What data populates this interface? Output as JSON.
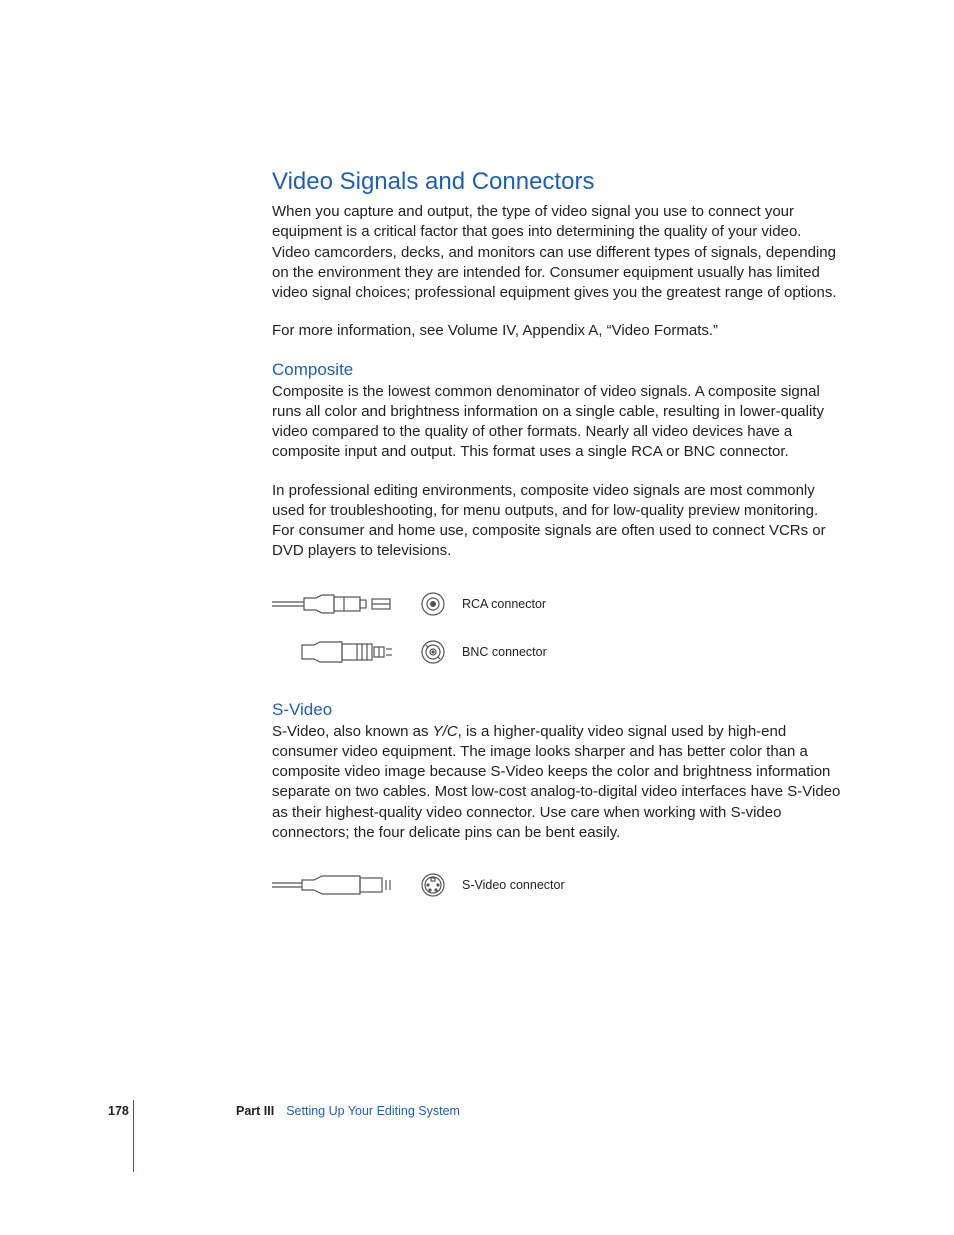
{
  "section": {
    "title": "Video Signals and Connectors",
    "intro_p1": "When you capture and output, the type of video signal you use to connect your equipment is a critical factor that goes into determining the quality of your video. Video camcorders, decks, and monitors can use different types of signals, depending on the environment they are intended for. Consumer equipment usually has limited video signal choices; professional equipment gives you the greatest range of options.",
    "intro_p2": "For more information, see Volume IV, Appendix A, “Video Formats.”"
  },
  "composite": {
    "heading": "Composite",
    "p1": "Composite is the lowest common denominator of video signals. A composite signal runs all color and brightness information on a single cable, resulting in lower-quality video compared to the quality of other formats. Nearly all video devices have a composite input and output. This format uses a single RCA or BNC connector.",
    "p2": "In professional editing environments, composite video signals are most commonly used for troubleshooting, for menu outputs, and for low-quality preview monitoring. For consumer and home use, composite signals are often used to connect VCRs or DVD players to televisions.",
    "connectors": [
      {
        "label": "RCA connector"
      },
      {
        "label": "BNC connector"
      }
    ]
  },
  "svideo": {
    "heading": "S-Video",
    "p1_pre": "S-Video, also known as ",
    "p1_em": "Y/C",
    "p1_post": ", is a higher-quality video signal used by high-end consumer video equipment. The image looks sharper and has better color than a composite video image because S-Video keeps the color and brightness information separate on two cables. Most low-cost analog-to-digital video interfaces have S-Video as their highest-quality video connector. Use care when working with S-video connectors; the four delicate pins can be bent easily.",
    "connector_label": "S-Video connector"
  },
  "footer": {
    "page": "178",
    "part": "Part III",
    "title": "Setting Up Your Editing System"
  }
}
